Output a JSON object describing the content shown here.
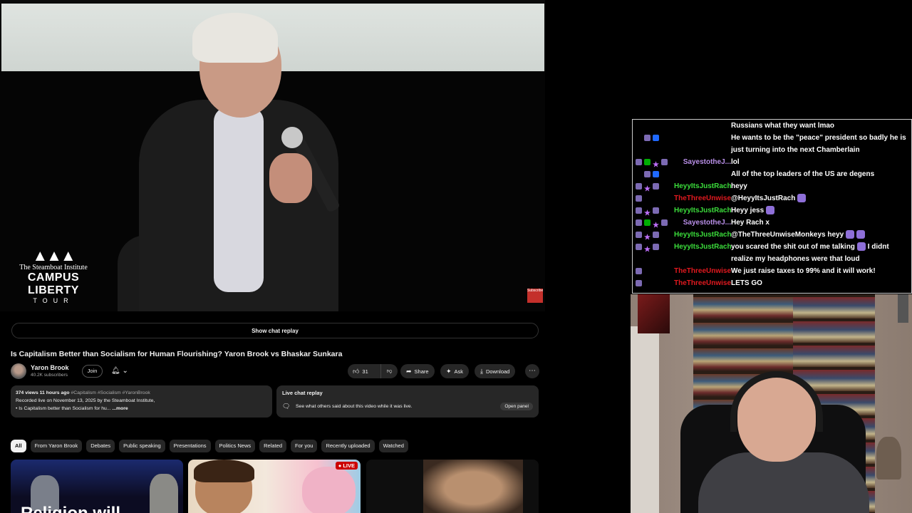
{
  "video": {
    "logo_line1": "The Steamboat Institute",
    "logo_line2": "CAMPUS LIBERTY",
    "logo_line3": "TOUR",
    "subscribe_badge": "Subscribe"
  },
  "show_chat_replay": "Show chat replay",
  "title": "Is Capitalism Better than Socialism for Human Flourishing? Yaron Brook vs Bhaskar Sunkara",
  "channel": {
    "name": "Yaron Brook",
    "subscribers": "40.2K subscribers",
    "join_label": "Join",
    "bell_icon": "bell-icon"
  },
  "actions": {
    "like_count": "31",
    "share_label": "Share",
    "ask_label": "Ask",
    "download_label": "Download"
  },
  "description": {
    "stats": "374 views  11 hours ago",
    "tags": "#Capitalism #Socialism #YaronBrook",
    "line2": "Recorded live on November 13, 2025 by the Steamboat Institute,",
    "line3": "• Is Capitalism better than Socialism for hu...",
    "more": "...more"
  },
  "live_chat_panel": {
    "heading": "Live chat replay",
    "text": "See what others said about this video while it was live.",
    "button": "Open panel"
  },
  "chips": [
    "All",
    "From Yaron Brook",
    "Debates",
    "Public speaking",
    "Presentations",
    "Politics News",
    "Related",
    "For you",
    "Recently uploaded",
    "Watched"
  ],
  "thumbnails": {
    "thumb1_text": "Religion will",
    "live_badge": "LIVE"
  },
  "chat": {
    "colors": {
      "green": "#3bdc3b",
      "red": "#e0191f",
      "purple": "#b98fe8"
    },
    "messages": [
      {
        "user": "",
        "text": "Russians what they want lmao",
        "color": "#ffffff"
      },
      {
        "user": "",
        "text": "He wants to be the \"peace\" president so badly he is",
        "text2": "just turning into the next Chamberlain",
        "color": "#ffffff"
      },
      {
        "user": "SayestotheJ...",
        "text": "lol",
        "color": "#b98fe8"
      },
      {
        "user": "",
        "text": "All of the top leaders of the US are degens",
        "color": "#ffffff"
      },
      {
        "user": "HeyyItsJustRach",
        "text": "heyy",
        "color": "#3bdc3b"
      },
      {
        "user": "TheThreeUnwiseMo...",
        "text": "@HeyyItsJustRach",
        "color": "#e0191f"
      },
      {
        "user": "HeyyItsJustRach",
        "text": "Heyy jess",
        "color": "#3bdc3b"
      },
      {
        "user": "SayestotheJ...",
        "text": "Hey Rach x",
        "color": "#b98fe8"
      },
      {
        "user": "HeyyItsJustRach",
        "text": "@TheThreeUnwiseMonkeys heyy",
        "color": "#3bdc3b"
      },
      {
        "user": "HeyyItsJustRach",
        "text": "you scared the shit out of me talking",
        "text2b": "I didnt",
        "text2": "realize my headphones were that loud",
        "color": "#3bdc3b"
      },
      {
        "user": "TheThreeUnwiseMo...",
        "text": "We just raise taxes to 99% and it will work!",
        "color": "#e0191f"
      },
      {
        "user": "TheThreeUnwiseMo...",
        "text": "LETS GO",
        "color": "#e0191f"
      }
    ]
  }
}
